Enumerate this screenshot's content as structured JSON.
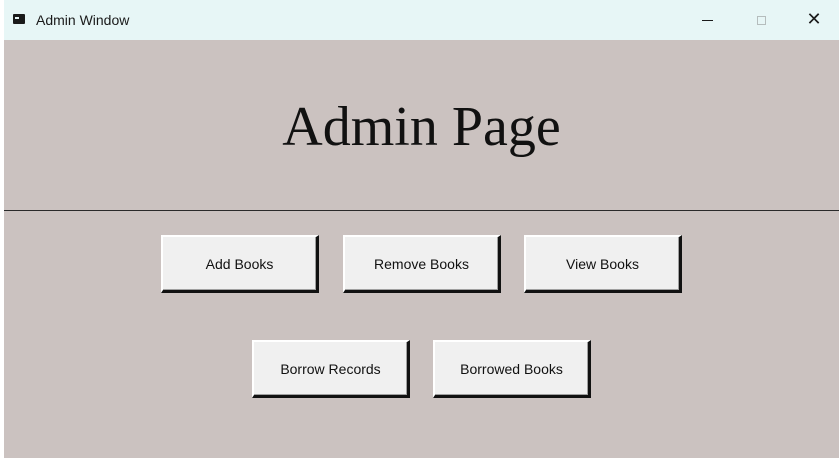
{
  "window": {
    "title": "Admin Window",
    "icon": "app-icon",
    "controls": {
      "minimize_icon": "minimize-icon",
      "maximize_icon": "maximize-icon",
      "close_icon": "close-icon",
      "close_glyph": "✕"
    }
  },
  "main": {
    "heading": "Admin Page",
    "buttons": [
      {
        "label": "Add Books"
      },
      {
        "label": "Remove Books"
      },
      {
        "label": "View Books"
      },
      {
        "label": "Borrow Records"
      },
      {
        "label": "Borrowed Books"
      }
    ]
  },
  "colors": {
    "background": "#cbc2c0",
    "titlebar": "#e7f6f6",
    "button_face": "#f0f0f0"
  }
}
